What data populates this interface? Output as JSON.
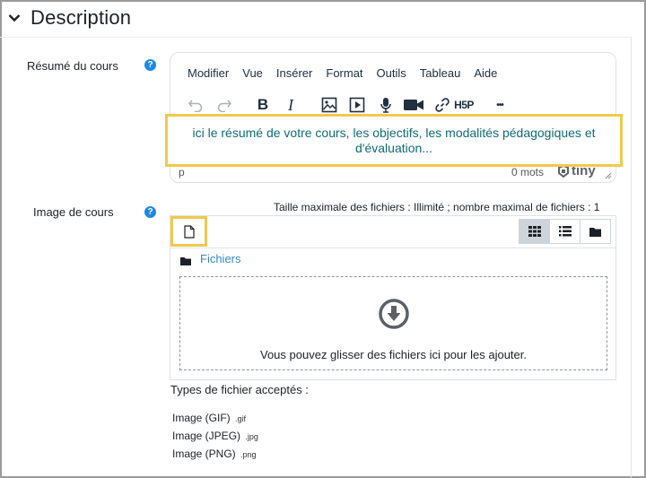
{
  "section": {
    "title": "Description"
  },
  "summary": {
    "label": "Résumé du cours",
    "menu": [
      "Modifier",
      "Vue",
      "Insérer",
      "Format",
      "Outils",
      "Tableau",
      "Aide"
    ],
    "toolbar_icons": [
      "undo-icon",
      "redo-icon",
      "bold-icon",
      "italic-icon",
      "image-icon",
      "media-icon",
      "record-audio-icon",
      "record-video-icon",
      "link-icon",
      "h5p-icon",
      "more-icon"
    ],
    "bold_glyph": "B",
    "italic_glyph": "I",
    "h5p_glyph": "H5P",
    "more_glyph": "•••",
    "content": "ici le résumé de votre cours, les objectifs, les modalités pédagogiques et d'évaluation...",
    "path": "p",
    "word_count": "0 mots",
    "brand": "tiny"
  },
  "course_image": {
    "label": "Image de cours",
    "limits": "Taille maximale des fichiers : Illimité ; nombre maximal de fichiers : 1",
    "folder_link": "Fichiers",
    "drop_text": "Vous pouvez glisser des fichiers ici pour les ajouter.",
    "accepted_label": "Types de fichier acceptés :",
    "types": [
      {
        "name": "Image (GIF)",
        "ext": ".gif"
      },
      {
        "name": "Image (JPEG)",
        "ext": ".jpg"
      },
      {
        "name": "Image (PNG)",
        "ext": ".png"
      }
    ]
  },
  "colors": {
    "highlight": "#f2c94c",
    "link": "#3a89c9",
    "help": "#1e88e5",
    "content_text": "#0f6c74"
  }
}
